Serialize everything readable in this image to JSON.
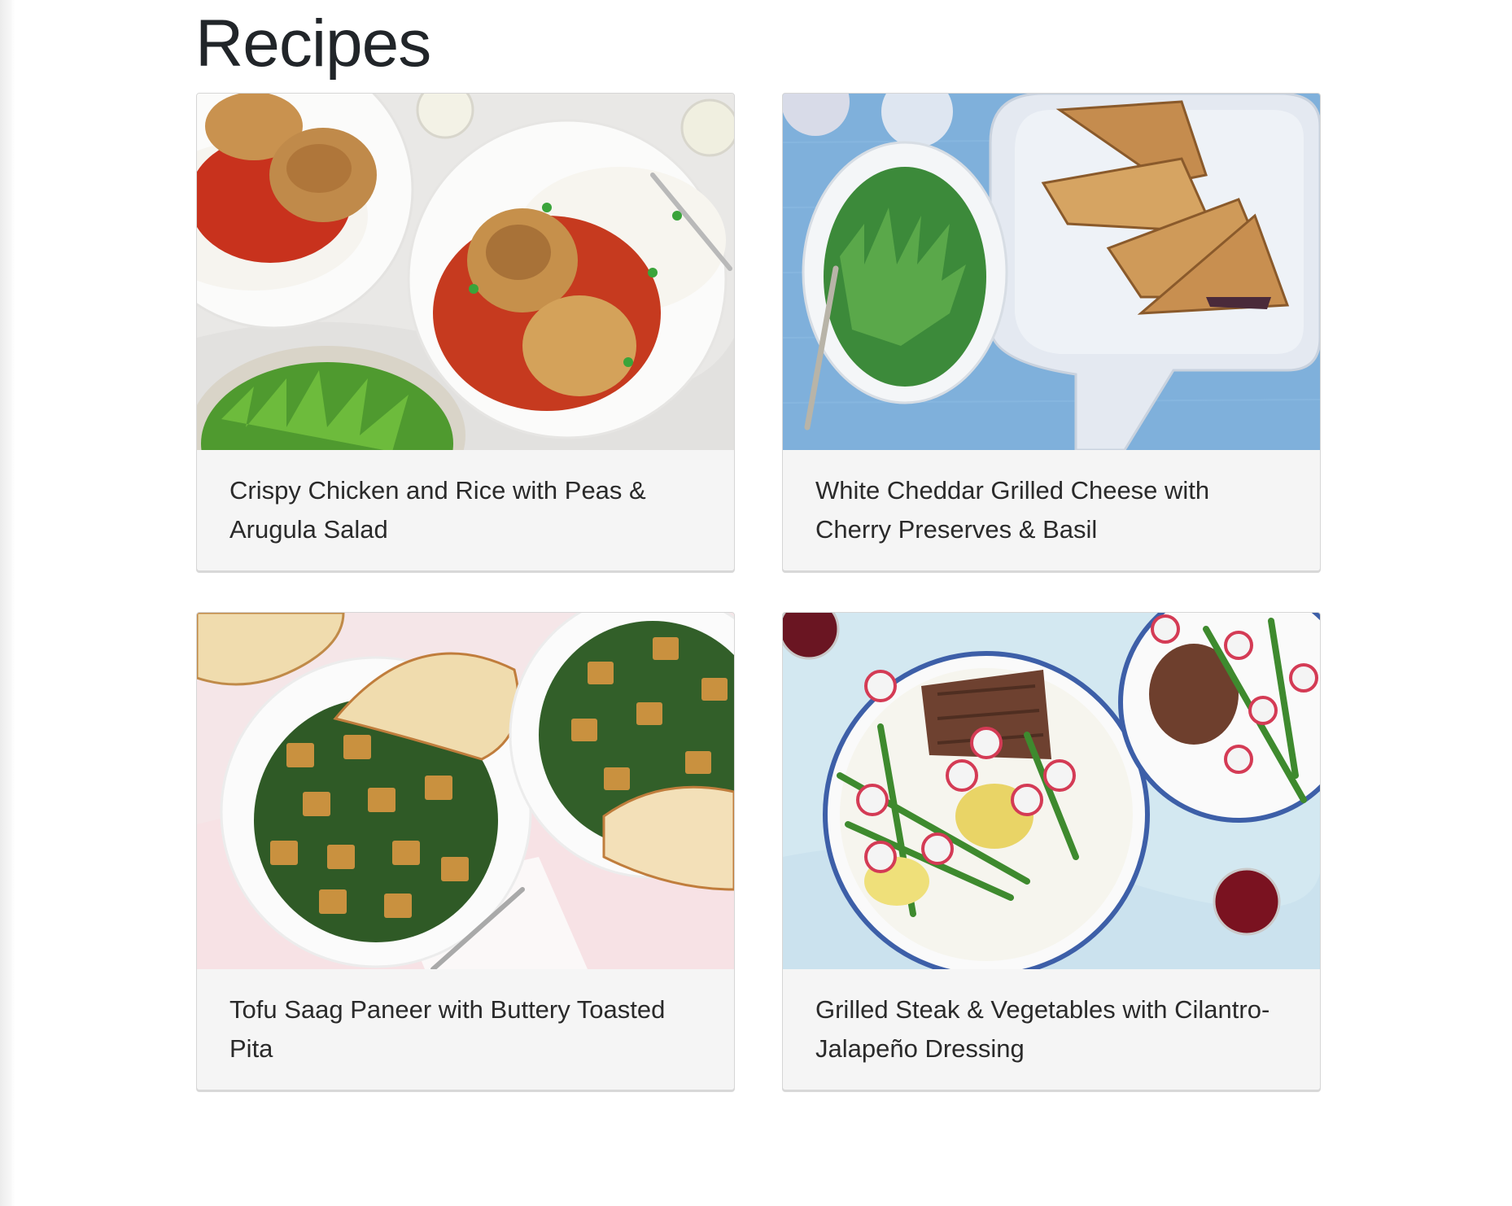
{
  "page": {
    "title": "Recipes"
  },
  "recipes": [
    {
      "title": "Crispy Chicken and Rice with Peas & Arugula Salad",
      "image_icon": "chicken-rice-photo",
      "bg": "#ecebea"
    },
    {
      "title": "White Cheddar Grilled Cheese with Cherry Preserves & Basil",
      "image_icon": "grilled-cheese-photo",
      "bg": "#7fb0da"
    },
    {
      "title": "Tofu Saag Paneer with Buttery Toasted Pita",
      "image_icon": "saag-paneer-photo",
      "bg": "#f6dfe2"
    },
    {
      "title": "Grilled Steak & Vegetables with Cilantro-Jalapeño Dressing",
      "image_icon": "steak-vegetables-photo",
      "bg": "#cfe6ef"
    }
  ]
}
